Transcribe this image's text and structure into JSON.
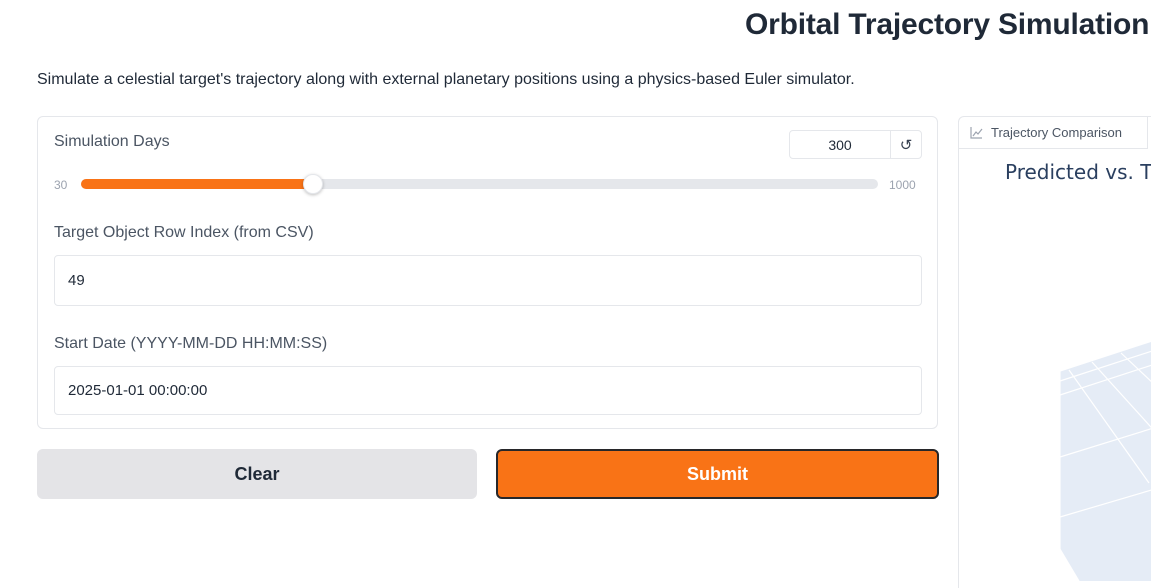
{
  "header": {
    "title": "Orbital Trajectory Simulation",
    "description": "Simulate a celestial target's trajectory along with external planetary positions using a physics-based Euler simulator."
  },
  "form": {
    "simulation_days": {
      "label": "Simulation Days",
      "value": "300",
      "min": "30",
      "max": "1000",
      "fraction": 0.291,
      "reset_icon": "reset-icon"
    },
    "target_index": {
      "label": "Target Object Row Index (from CSV)",
      "value": "49"
    },
    "start_date": {
      "label": "Start Date (YYYY-MM-DD HH:MM:SS)",
      "value": "2025-01-01 00:00:00"
    }
  },
  "buttons": {
    "clear_label": "Clear",
    "submit_label": "Submit"
  },
  "output": {
    "tab_label": "Trajectory Comparison",
    "tab_icon": "chart-icon",
    "plot_title": "Predicted vs. T"
  },
  "colors": {
    "accent": "#f97316",
    "plot_title": "#2a3f5f",
    "scene_background": "#e5ecf6"
  }
}
